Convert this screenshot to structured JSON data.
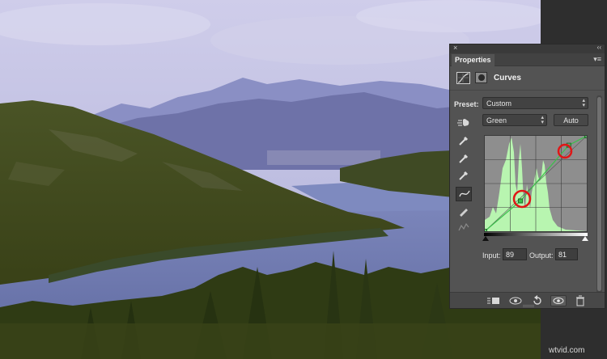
{
  "panel": {
    "close_glyph": "×",
    "collapse_glyph": "‹‹",
    "tab_title": "Properties",
    "menu_glyph": "▾≡",
    "adjustment_title": "Curves",
    "preset_label": "Preset:",
    "preset_value": "Custom",
    "channel_value": "Green",
    "auto_label": "Auto",
    "input_label": "Input:",
    "input_value": "89",
    "output_label": "Output:",
    "output_value": "81"
  },
  "icons": {
    "adjustment_icon": "curves-icon",
    "mask_icon": "layer-mask-icon",
    "tools": [
      "on-image-adjust-icon",
      "black-point-eyedropper-icon",
      "gray-point-eyedropper-icon",
      "white-point-eyedropper-icon",
      "curve-point-tool-icon",
      "pencil-tool-icon",
      "smooth-icon"
    ],
    "footer": [
      "clip-to-layer-icon",
      "view-previous-icon",
      "reset-icon",
      "visibility-eye-icon",
      "trash-icon"
    ]
  },
  "curve": {
    "channel_color": "#39c14a",
    "histogram_color": "#b8f5b0",
    "highlight_color": "#e01616",
    "points": [
      [
        0,
        0
      ],
      [
        89,
        81
      ],
      [
        210,
        230
      ],
      [
        255,
        255
      ]
    ]
  },
  "watermark": "wtvid.com"
}
